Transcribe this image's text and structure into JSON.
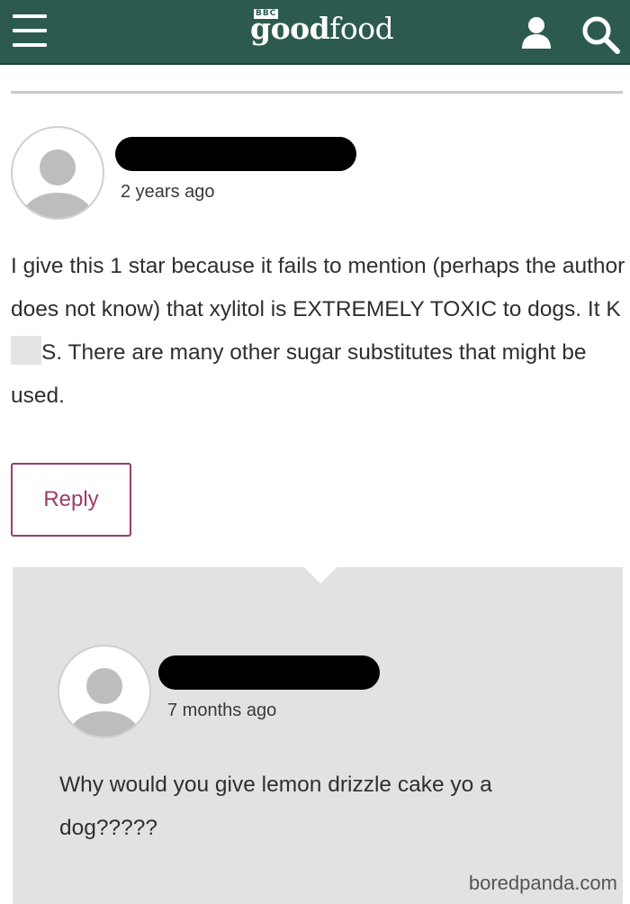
{
  "header": {
    "brand_prefix": "BBC",
    "brand_good": "good",
    "brand_food": "food",
    "menu_icon": "hamburger-menu-icon",
    "account_icon": "user-icon",
    "search_icon": "search-icon",
    "background_color": "#2c5a4f"
  },
  "comment": {
    "timestamp": "2 years ago",
    "body_part1": "I give this 1 star because it fails to mention (perhaps the author does not know) that xylitol is EXTREMELY TOXIC to dogs. It K",
    "body_part2": "S. There are many other sugar substitutes that might be used.",
    "reply_label": "Reply"
  },
  "reply": {
    "timestamp": "7 months ago",
    "body": "Why would you give lemon drizzle cake yo a dog?????"
  },
  "watermark": "boredpanda.com",
  "colors": {
    "accent": "#9a3c6b",
    "panel": "#e2e2e2"
  }
}
